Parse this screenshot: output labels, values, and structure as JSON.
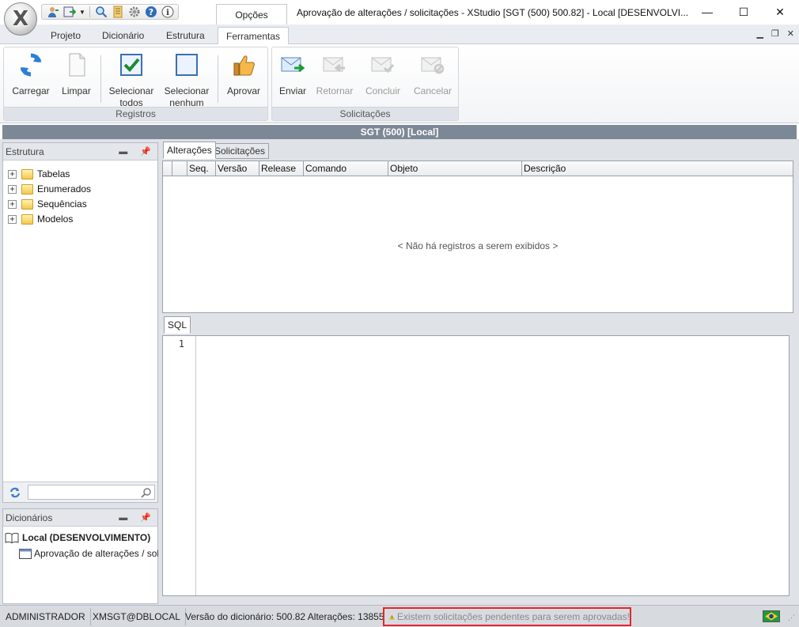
{
  "window": {
    "title": "Aprovação de alterações / solicitações - XStudio [SGT (500) 500.82] - Local [DESENVOLVI...",
    "app_logo": "X",
    "options_tab": "Opções",
    "minimize_label": "—",
    "maximize_label": "☐",
    "close_label": "✕"
  },
  "quick_access": {
    "icons": [
      "user-icon",
      "export-icon",
      "dropdown-icon",
      "search-icon",
      "notebook-icon",
      "gear-icon",
      "help-icon",
      "info-icon"
    ]
  },
  "ribbon": {
    "tabs": [
      {
        "label": "Projeto"
      },
      {
        "label": "Dicionário"
      },
      {
        "label": "Estrutura"
      },
      {
        "label": "Ferramentas",
        "active": true
      }
    ],
    "groups": {
      "registros": {
        "label": "Registros",
        "buttons": [
          {
            "label": "Carregar",
            "icon": "refresh-icon"
          },
          {
            "label": "Limpar",
            "icon": "blank-page-icon"
          },
          {
            "label": "Selecionar\ntodos",
            "icon": "checkbox-checked-icon"
          },
          {
            "label": "Selecionar\nnenhum",
            "icon": "checkbox-empty-icon"
          }
        ]
      },
      "aprovar": {
        "label": "Aprovar",
        "icon": "thumbs-up-icon"
      },
      "solicitacoes": {
        "label": "Solicitações",
        "buttons": [
          {
            "label": "Enviar",
            "icon": "mail-send-icon",
            "enabled": true
          },
          {
            "label": "Retornar",
            "icon": "mail-return-icon",
            "enabled": false
          },
          {
            "label": "Concluir",
            "icon": "mail-check-icon",
            "enabled": false
          },
          {
            "label": "Cancelar",
            "icon": "mail-cancel-icon",
            "enabled": false
          }
        ]
      }
    }
  },
  "header_strip": "SGT (500) [Local]",
  "estrutura_panel": {
    "title": "Estrutura",
    "items": [
      {
        "label": "Tabelas"
      },
      {
        "label": "Enumerados"
      },
      {
        "label": "Sequências"
      },
      {
        "label": "Modelos"
      }
    ],
    "search_placeholder": ""
  },
  "dicionarios_panel": {
    "title": "Dicionários",
    "root": "Local (DESENVOLVIMENTO)",
    "child": "Aprovação de alterações / solici"
  },
  "main": {
    "tabs": [
      {
        "label": "Alterações",
        "active": true
      },
      {
        "label": "Solicitações",
        "active": false
      }
    ],
    "grid_columns": [
      "Seq.",
      "Versão",
      "Release",
      "Comando",
      "Objeto",
      "Descrição"
    ],
    "empty_message": "< Não há registros a serem exibidos >",
    "sql_tab": "SQL",
    "sql_line": "1"
  },
  "statusbar": {
    "user": "ADMINISTRADOR",
    "connection": "XMSGT@DBLOCAL",
    "version": "Versão do dicionário: 500.82 Alterações: 13855",
    "warning": "Existem solicitações pendentes para serem aprovadas!",
    "locale_flag": "brazil-flag-icon"
  },
  "colors": {
    "header_strip": "#7d8896",
    "warning_border": "#e3262b",
    "ribbon_group_label": "#dfe3e9"
  }
}
